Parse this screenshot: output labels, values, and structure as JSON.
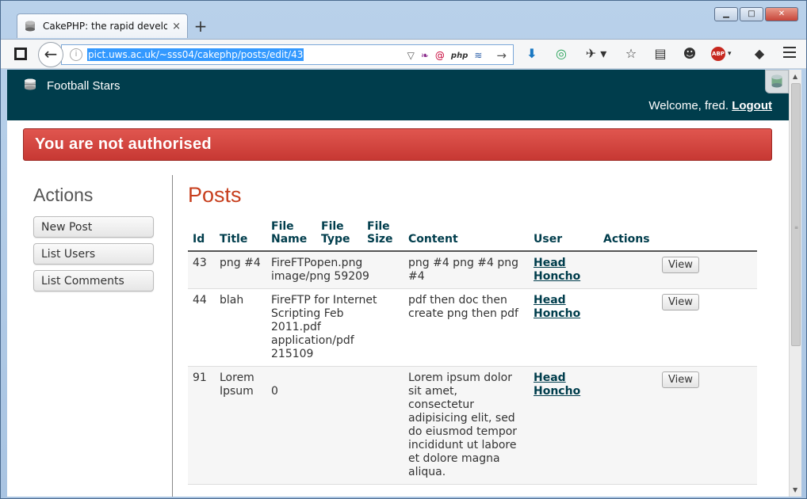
{
  "browser": {
    "tab_title": "CakePHP: the rapid develo...",
    "tab_close": "×",
    "new_tab": "+",
    "url": "pict.uws.ac.uk/~sss04/cakephp/posts/edit/43",
    "url_php_badge": "php",
    "window_buttons": {
      "minimize": "▁",
      "maximize": "□",
      "close": "✕"
    }
  },
  "site": {
    "title": "Football Stars",
    "welcome": "Welcome, fred. ",
    "logout": "Logout"
  },
  "flash": "You are not authorised",
  "actions": {
    "heading": "Actions",
    "buttons": [
      "New Post",
      "List Users",
      "List Comments"
    ]
  },
  "posts": {
    "heading": "Posts",
    "columns": [
      "Id",
      "Title",
      "File Name",
      "File Type",
      "File Size",
      "Content",
      "User",
      "Actions"
    ],
    "rows": [
      {
        "id": "43",
        "title": "png #4",
        "file": "FireFTPopen.png image/png 59209",
        "content": "png #4 png #4 png #4",
        "user": "Head Honcho",
        "action": "View"
      },
      {
        "id": "44",
        "title": "blah",
        "file": "FireFTP for Internet Scripting Feb 2011.pdf application/pdf 215109",
        "content": "pdf then doc then create png then pdf",
        "user": "Head Honcho",
        "action": "View"
      },
      {
        "id": "91",
        "title": "Lorem Ipsum",
        "file": "0",
        "content": "Lorem ipsum dolor sit amet, consectetur adipisicing elit, sed do eiusmod tempor incididunt ut labore et dolore magna aliqua.",
        "user": "Head Honcho",
        "action": "View"
      }
    ]
  }
}
